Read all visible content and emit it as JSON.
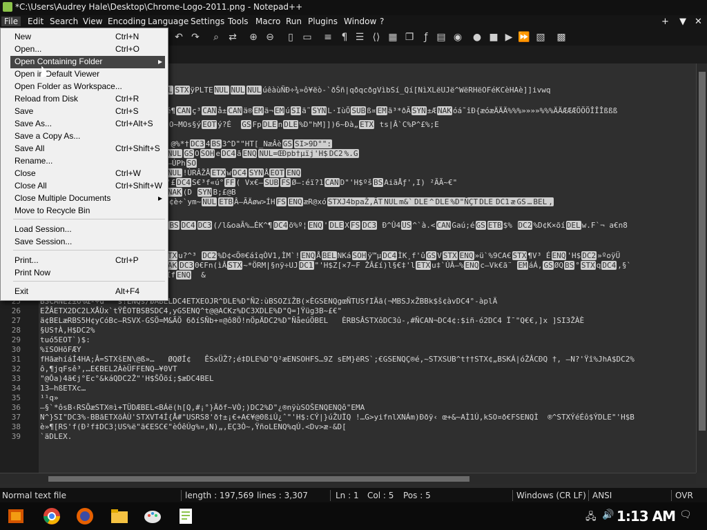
{
  "window": {
    "title": "*C:\\Users\\Audrey Hale\\Desktop\\Chrome-Logo-2011.png - Notepad++"
  },
  "menubar": {
    "items": [
      "File",
      "Edit",
      "Search",
      "View",
      "Encoding",
      "Language",
      "Settings",
      "Tools",
      "Macro",
      "Run",
      "Plugins",
      "Window",
      "?"
    ],
    "right": [
      "+",
      "▼",
      "✕"
    ]
  },
  "file_menu": {
    "groups": [
      [
        {
          "label": "New",
          "shortcut": "Ctrl+N"
        },
        {
          "label": "Open...",
          "shortcut": "Ctrl+O"
        },
        {
          "label": "Open Containing Folder",
          "shortcut": "",
          "submenu": true,
          "highlighted": true
        },
        {
          "label": "Open in Default Viewer",
          "shortcut": ""
        },
        {
          "label": "Open Folder as Workspace...",
          "shortcut": ""
        },
        {
          "label": "Reload from Disk",
          "shortcut": "Ctrl+R"
        },
        {
          "label": "Save",
          "shortcut": "Ctrl+S"
        },
        {
          "label": "Save As...",
          "shortcut": "Ctrl+Alt+S"
        },
        {
          "label": "Save a Copy As...",
          "shortcut": ""
        },
        {
          "label": "Save All",
          "shortcut": "Ctrl+Shift+S"
        },
        {
          "label": "Rename...",
          "shortcut": ""
        },
        {
          "label": "Close",
          "shortcut": "Ctrl+W"
        },
        {
          "label": "Close All",
          "shortcut": "Ctrl+Shift+W"
        },
        {
          "label": "Close Multiple Documents",
          "shortcut": "",
          "submenu": true
        },
        {
          "label": "Move to Recycle Bin",
          "shortcut": ""
        }
      ],
      [
        {
          "label": "Load Session...",
          "shortcut": ""
        },
        {
          "label": "Save Session...",
          "shortcut": ""
        }
      ],
      [
        {
          "label": "Print...",
          "shortcut": "Ctrl+P"
        },
        {
          "label": "Print Now",
          "shortcut": ""
        }
      ],
      [
        {
          "label": "Exit",
          "shortcut": "Alt+F4"
        }
      ]
    ]
  },
  "editor": {
    "line_numbers": [
      "25",
      "26",
      "27",
      "28",
      "29",
      "30",
      "31",
      "32",
      "33",
      "34",
      "35",
      "36",
      "37",
      "38",
      "39"
    ],
    "lines_visible": [
      "BSCANÈz±6%Œº÷ù   s!ENQs/ØÅBELDC4ETXEOJR^DLE%D\"Ñ2:ùBSOZïŽB(×ÈGSENQgœÑTUSfIÄã(¬MBSJxŽBBk$š¢àvDC4°-àplÄ",
      "EŽÂETX2DC2LXÅÙx`tŸÊOTBSBSDC4,yGSENQ^t@@ACKz%DC3XDLE%D\"Q=]Ÿüg3B~£€\"",
      "ä¢BELæRBS5H¢yCóBc–RSVX-GSÖ=M&ÃÖ 6ðíSÑb+¤@ô8Ö!nÖpÄDC2%D\"ÑåeúÖBEL   ÈRBSÂSTXôDC3û-,#ÑCAN¬DC4¢:$iñ-ó2DC4 Ï¯\"Q€€,]x ]SI3ŽÀÈ",
      "§US†À,H$DC2%",
      "tuó5EOT`)$:",
      "%ïSOHõFÆY",
      "fHãæhíáÍ4HA;Â=STXšEN\\@ß»…   ØQØÍ¢   ÊSxÜŽ?;é‡DLE%D\"Q²æENSOHFS…9Z sEM}ëRS`;€GSENQÇ®é,~STXSUB^t††STX¢„BSKÁ|óŽÂCÐQ †, –N?'Ÿî%JhA$DC2%",
      "ô,¶jqFsê³,…E€BEL2ÀèÜFFENQ–¥0VT",
      "\"@Ôa)4ã€j°Ec°&káQDC2Ž\"'H$ŠÕõí;$æDC4BEL",
      "13–hßETXc…",
      "¹¹q»",
      "–§`*ôsB‹RSÕæSTX®ì+TÜDÆBEL<BÁë(h[Q,#¡°}Äðf~VÒ;)DC2%D\"¿®nÿùSOŠENQENQô\"EMA",
      "N^}SI\"DC3%-BBãETXõÀÙ'STXVT4Í{Å#\"USRS8'ð†±¡€+A€¥@0ßiÚ¿ˆ\"'H$:CÝ|}úŽUÏQ !…G>yifnlXNÁm)Ððÿ‹ œ+&~AÌ1Ú,kSO¤ð€FSENQÌ  ®^STXÝéÉô$ÝDLE\"'H$B",
      "è»¶[RS'f(Ð²f‡DC3¦US%ë\"ã€ESC€\"èÓêÚg%¤,N)„,EÇ3Ò~,ŸñoLENQ%qÚ.<Dv>æ-&D[",
      "`äDLEX."
    ]
  },
  "status": {
    "type": "Normal text file",
    "length": "length : 197,569",
    "lines": "lines : 3,307",
    "ln": "Ln : 1",
    "col": "Col : 5",
    "pos": "Pos : 5",
    "eol": "Windows (CR LF)",
    "encoding": "ANSI",
    "mode": "OVR"
  },
  "taskbar": {
    "clock": "1:13 AM"
  },
  "colors": {
    "accent": "#8bc34a",
    "menu_highlight": "#444444"
  }
}
